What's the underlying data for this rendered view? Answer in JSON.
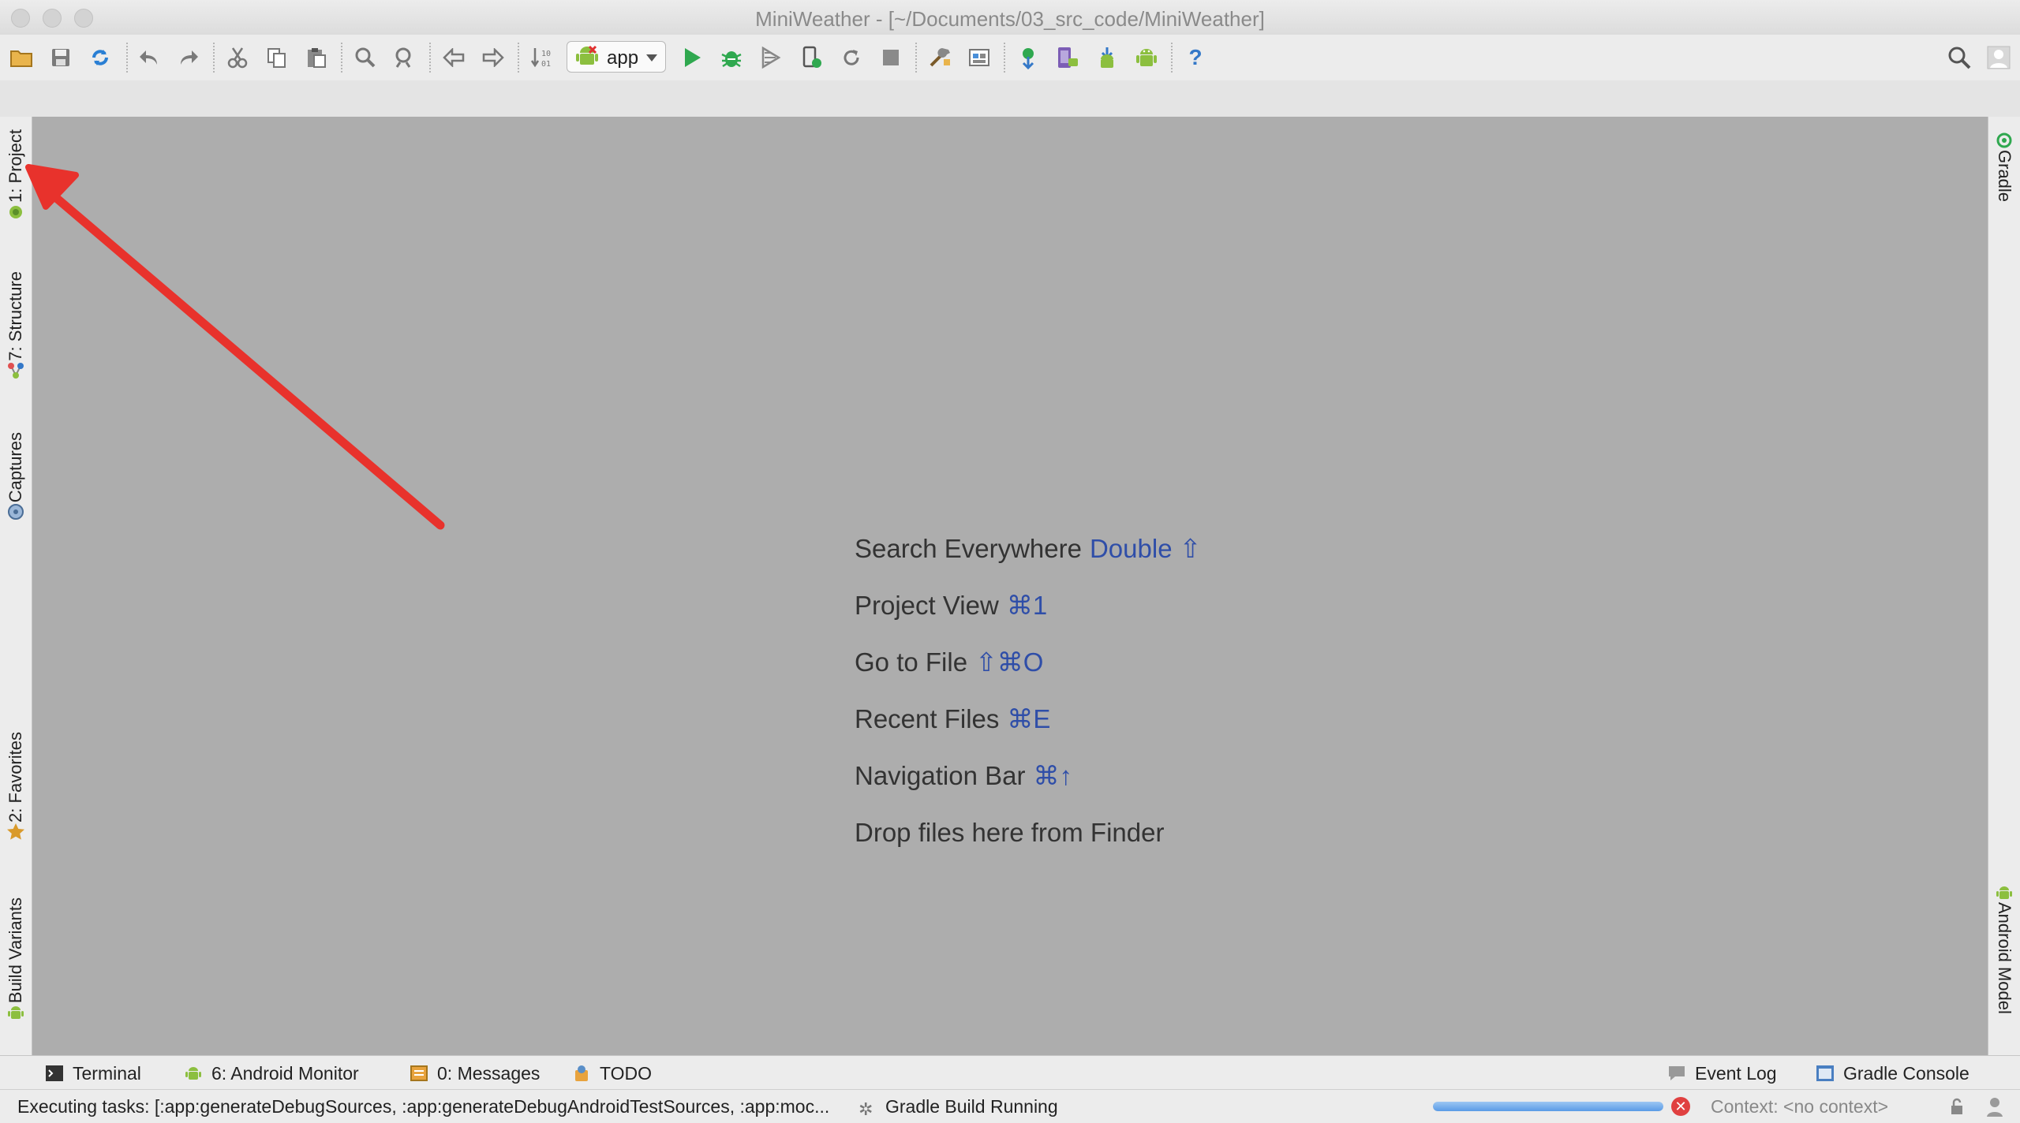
{
  "window": {
    "title": "MiniWeather - [~/Documents/03_src_code/MiniWeather]"
  },
  "toolbar": {
    "run_config": "app",
    "icons": [
      "open-folder-icon",
      "save-icon",
      "sync-icon",
      "undo-icon",
      "redo-icon",
      "cut-icon",
      "copy-icon",
      "paste-icon",
      "find-icon",
      "replace-icon",
      "back-icon",
      "forward-icon",
      "make-project-icon",
      "android-icon",
      "run-icon",
      "debug-icon",
      "coverage-icon",
      "attach-debugger-icon",
      "apply-changes-icon",
      "stop-icon",
      "project-structure-icon",
      "sdk-manager-icon",
      "sync-gradle-icon",
      "avd-manager-icon",
      "sdk-download-icon",
      "android-device-icon",
      "help-icon",
      "search-icon",
      "user-icon"
    ]
  },
  "left_tabs": [
    {
      "label": "1: Project"
    },
    {
      "label": "7: Structure"
    },
    {
      "label": "Captures"
    },
    {
      "label": "2: Favorites"
    },
    {
      "label": "Build Variants"
    }
  ],
  "right_tabs": [
    {
      "label": "Gradle"
    },
    {
      "label": "Android Model"
    }
  ],
  "editor_hints": [
    {
      "label": "Search Everywhere",
      "key": "Double ⇧"
    },
    {
      "label": "Project View",
      "key": "⌘1"
    },
    {
      "label": "Go to File",
      "key": "⇧⌘O"
    },
    {
      "label": "Recent Files",
      "key": "⌘E"
    },
    {
      "label": "Navigation Bar",
      "key": "⌘↑"
    },
    {
      "label": "Drop files here from Finder",
      "key": ""
    }
  ],
  "bottom_tabs": {
    "terminal": "Terminal",
    "android_monitor": "6: Android Monitor",
    "messages": "0: Messages",
    "todo": "TODO",
    "event_log": "Event Log",
    "gradle_console": "Gradle Console"
  },
  "status": {
    "text": "Executing tasks: [:app:generateDebugSources, :app:generateDebugAndroidTestSources, :app:moc...",
    "task": "Gradle Build Running",
    "progress_percent": 100,
    "context": "Context: <no context>"
  },
  "colors": {
    "editor_bg": "#adadad",
    "shortcut_key": "#2f4ea8",
    "annotation_arrow": "#e8322c"
  }
}
